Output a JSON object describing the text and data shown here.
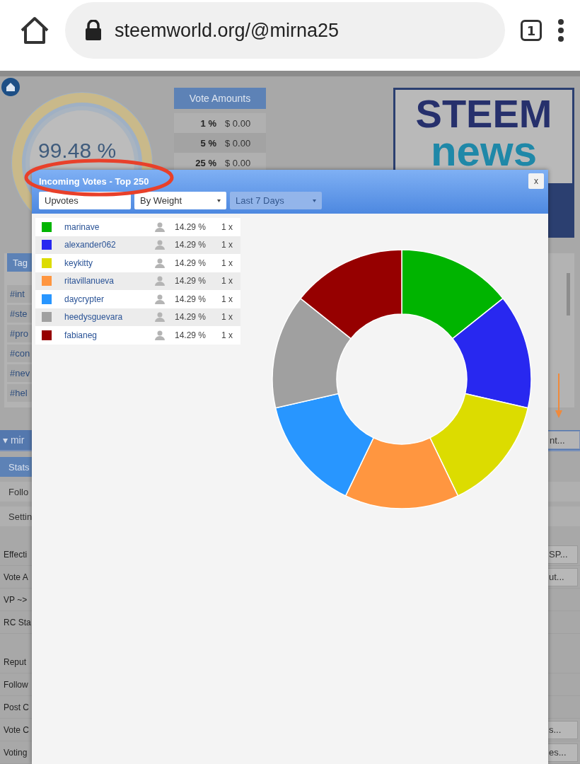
{
  "browser": {
    "url": "steemworld.org/@mirna25",
    "tab_count": "1"
  },
  "header": {
    "gauge_value": "99.48 %",
    "vote_amounts": {
      "title": "Vote Amounts",
      "rows": [
        {
          "percent": "1 %",
          "value": "$ 0.00"
        },
        {
          "percent": "5 %",
          "value": "$ 0.00"
        },
        {
          "percent": "25 %",
          "value": "$ 0.00"
        }
      ]
    },
    "logo": {
      "line1": "STEEM",
      "line2": "news"
    }
  },
  "tags_panel": {
    "button": "Tag",
    "tags": [
      "#int",
      "#ste",
      "#pro",
      "#con",
      "#nev",
      "#hel"
    ]
  },
  "account": {
    "name": "mir",
    "caret": "▾",
    "field": "nt...",
    "tabs": [
      {
        "label": "Stats",
        "selected": true
      },
      {
        "label": "Follo",
        "selected": false
      },
      {
        "label": "Settin",
        "selected": false
      }
    ],
    "groups": [
      [
        {
          "label": "Effecti",
          "action": "SP..."
        },
        {
          "label": "Vote A",
          "action": "ut..."
        },
        {
          "label": "VP ~>"
        },
        {
          "label": "RC Sta"
        }
      ],
      [
        {
          "label": "Reput"
        },
        {
          "label": "Follow"
        },
        {
          "label": "Post C"
        },
        {
          "label": "Vote C",
          "action": "s..."
        },
        {
          "label": "Voting",
          "action": "es..."
        }
      ]
    ]
  },
  "modal": {
    "title": "Incoming Votes - Top 250",
    "close": "x",
    "filters": [
      {
        "value": "Upvotes",
        "disabled": false,
        "dropdown": false
      },
      {
        "value": "By Weight",
        "disabled": false,
        "dropdown": true
      },
      {
        "value": "Last 7 Days",
        "disabled": true,
        "dropdown": true
      }
    ],
    "votes": [
      {
        "name": "marinave",
        "color": "#00b400",
        "share": "14.29 %",
        "count": "1 x"
      },
      {
        "name": "alexander062",
        "color": "#2828f0",
        "share": "14.29 %",
        "count": "1 x"
      },
      {
        "name": "keykitty",
        "color": "#dcdc00",
        "share": "14.29 %",
        "count": "1 x"
      },
      {
        "name": "ritavillanueva",
        "color": "#ff9640",
        "share": "14.29 %",
        "count": "1 x"
      },
      {
        "name": "daycrypter",
        "color": "#2896ff",
        "share": "14.29 %",
        "count": "1 x"
      },
      {
        "name": "heedysguevara",
        "color": "#a0a0a0",
        "share": "14.29 %",
        "count": "1 x"
      },
      {
        "name": "fabianeg",
        "color": "#960000",
        "share": "14.29 %",
        "count": "1 x"
      }
    ],
    "chart_data": {
      "type": "donut",
      "values": [
        14.29,
        14.29,
        14.29,
        14.29,
        14.29,
        14.29,
        14.29
      ]
    }
  }
}
